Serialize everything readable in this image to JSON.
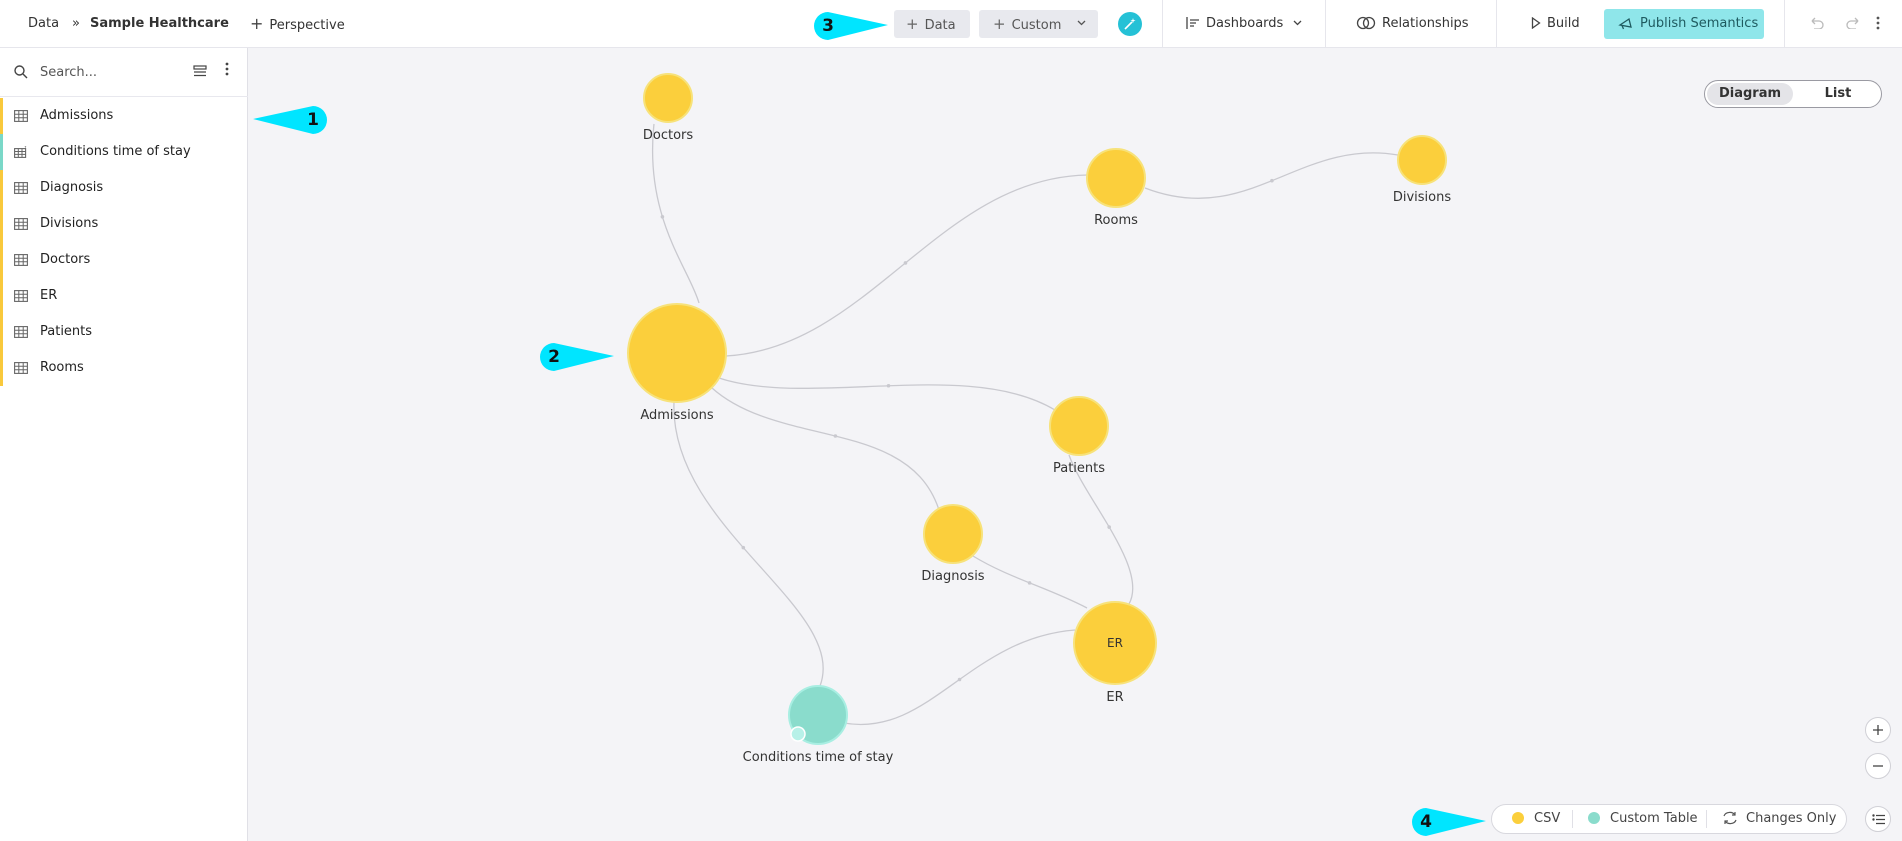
{
  "header": {
    "breadcrumb_root": "Data",
    "breadcrumb_sep": "»",
    "model_name": "Sample Healthcare",
    "perspective_label": "Perspective",
    "data_button": "Data",
    "custom_button": "Custom",
    "dashboards_label": "Dashboards",
    "relationships_label": "Relationships",
    "build_label": "Build",
    "publish_label": "Publish Semantics"
  },
  "sidebar": {
    "search_placeholder": "Search...",
    "items": [
      {
        "label": "Admissions",
        "type": "csv"
      },
      {
        "label": "Conditions time of stay",
        "type": "custom"
      },
      {
        "label": "Diagnosis",
        "type": "csv"
      },
      {
        "label": "Divisions",
        "type": "csv"
      },
      {
        "label": "Doctors",
        "type": "csv"
      },
      {
        "label": "ER",
        "type": "csv"
      },
      {
        "label": "Patients",
        "type": "csv"
      },
      {
        "label": "Rooms",
        "type": "csv"
      }
    ]
  },
  "view_toggle": {
    "diagram": "Diagram",
    "list": "List",
    "active": "diagram"
  },
  "diagram": {
    "nodes": [
      {
        "id": "doctors",
        "label": "Doctors",
        "type": "csv"
      },
      {
        "id": "rooms",
        "label": "Rooms",
        "type": "csv"
      },
      {
        "id": "divisions",
        "label": "Divisions",
        "type": "csv"
      },
      {
        "id": "admissions",
        "label": "Admissions",
        "type": "csv"
      },
      {
        "id": "patients",
        "label": "Patients",
        "type": "csv"
      },
      {
        "id": "diagnosis",
        "label": "Diagnosis",
        "type": "csv"
      },
      {
        "id": "er",
        "label": "ER",
        "type": "csv",
        "inner_label": "ER"
      },
      {
        "id": "conditions",
        "label": "Conditions time of stay",
        "type": "custom"
      }
    ],
    "edges": [
      [
        "admissions",
        "doctors"
      ],
      [
        "admissions",
        "rooms"
      ],
      [
        "rooms",
        "divisions"
      ],
      [
        "admissions",
        "patients"
      ],
      [
        "admissions",
        "diagnosis"
      ],
      [
        "admissions",
        "conditions"
      ],
      [
        "patients",
        "er"
      ],
      [
        "diagnosis",
        "er"
      ],
      [
        "conditions",
        "er"
      ]
    ]
  },
  "legend": {
    "csv_label": "CSV",
    "custom_label": "Custom Table",
    "changes_label": "Changes Only"
  },
  "colors": {
    "csv": "#fbcf3c",
    "csv_stroke": "#f7e27a",
    "custom": "#8adccc",
    "custom_stroke": "#a8eee2",
    "accent": "#00e5ff",
    "publish_bg": "#8fe6ea"
  },
  "callouts": [
    "1",
    "2",
    "3",
    "4"
  ]
}
